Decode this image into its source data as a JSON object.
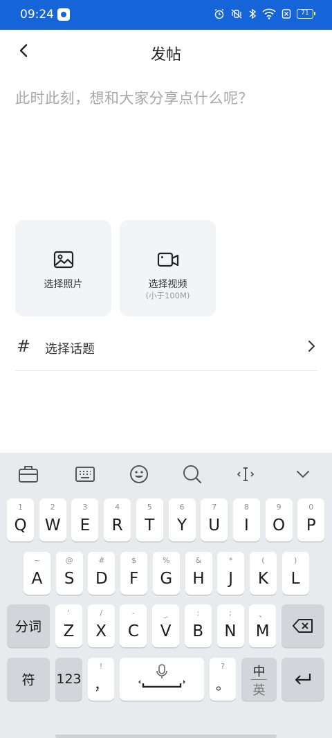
{
  "status_bar": {
    "time": "09:24",
    "battery": "71"
  },
  "header": {
    "title": "发帖"
  },
  "compose": {
    "placeholder": "此时此刻，想和大家分享点什么呢？"
  },
  "media": {
    "photo_label": "选择照片",
    "video_label": "选择视频",
    "video_limit": "(小于100M)"
  },
  "topic": {
    "label": "选择话题"
  },
  "keyboard": {
    "row1": [
      {
        "num": "1",
        "ch": "Q"
      },
      {
        "num": "2",
        "ch": "W"
      },
      {
        "num": "3",
        "ch": "E"
      },
      {
        "num": "4",
        "ch": "R"
      },
      {
        "num": "5",
        "ch": "T"
      },
      {
        "num": "6",
        "ch": "Y"
      },
      {
        "num": "7",
        "ch": "U"
      },
      {
        "num": "8",
        "ch": "I"
      },
      {
        "num": "9",
        "ch": "O"
      },
      {
        "num": "0",
        "ch": "P"
      }
    ],
    "row2": [
      {
        "num": "~",
        "ch": "A"
      },
      {
        "num": "@",
        "ch": "S"
      },
      {
        "num": "#",
        "ch": "D"
      },
      {
        "num": "$",
        "ch": "F"
      },
      {
        "num": "%",
        "ch": "G"
      },
      {
        "num": "&",
        "ch": "H"
      },
      {
        "num": "*",
        "ch": "J"
      },
      {
        "num": "(",
        "ch": "K"
      },
      {
        "num": ")",
        "ch": "L"
      }
    ],
    "row3": [
      {
        "num": "'",
        "ch": "Z"
      },
      {
        "num": "/",
        "ch": "X"
      },
      {
        "num": "-",
        "ch": "C"
      },
      {
        "num": "_",
        "ch": "V"
      },
      {
        "num": ":",
        "ch": "B"
      },
      {
        "num": ";",
        "ch": "N"
      },
      {
        "num": "、",
        "ch": "M"
      }
    ],
    "segment_key": "分词",
    "symbol_key": "符",
    "numeric_key": "123",
    "comma_top": "!",
    "comma": "，",
    "period_top": "?",
    "period": "。",
    "lang_top": "中",
    "lang_bottom": "英"
  }
}
